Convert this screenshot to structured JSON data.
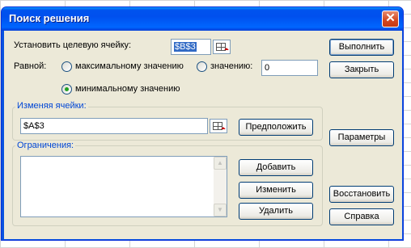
{
  "dialog": {
    "title": "Поиск решения",
    "close_glyph": "✕"
  },
  "target_cell": {
    "label": "Установить целевую ячейку:",
    "value": "$B$3"
  },
  "equal_to": {
    "label": "Равной:",
    "max_label": "максимальному значению",
    "value_label": "значению:",
    "value": "0",
    "min_label": "минимальному значению",
    "selected": "min"
  },
  "changing_cells": {
    "label": "Изменяя ячейки:",
    "value": "$A$3",
    "guess_button": "Предположить"
  },
  "constraints": {
    "label": "Ограничения:",
    "items": [],
    "add_button": "Добавить",
    "change_button": "Изменить",
    "delete_button": "Удалить"
  },
  "buttons": {
    "solve": "Выполнить",
    "close": "Закрыть",
    "options": "Параметры",
    "reset": "Восстановить",
    "help": "Справка"
  },
  "colors": {
    "title_bar": "#0053ee",
    "dialog_bg": "#ece9d8",
    "group_label": "#0046d5",
    "selection": "#316ac5"
  }
}
